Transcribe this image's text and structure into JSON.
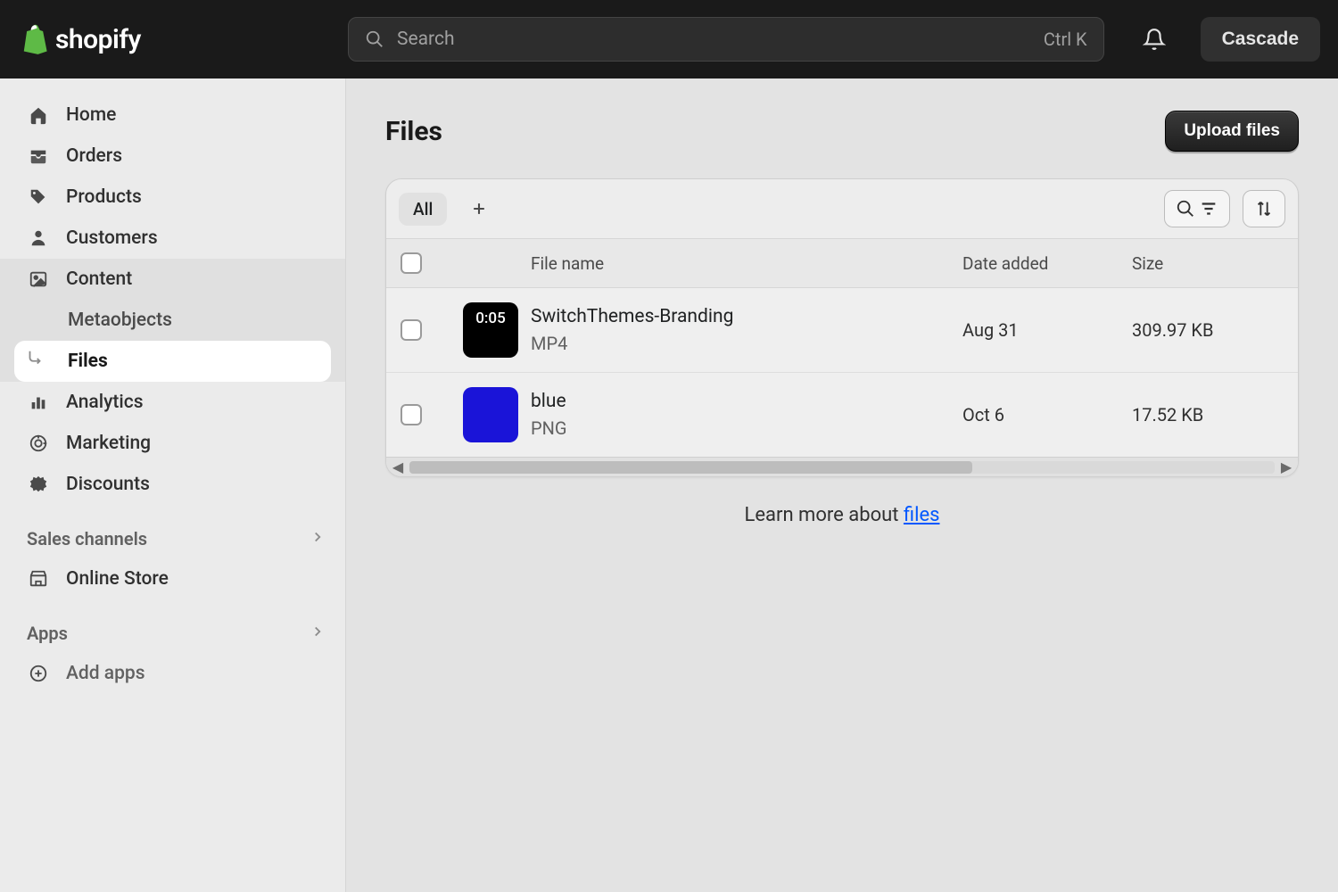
{
  "brand": "shopify",
  "search": {
    "placeholder": "Search",
    "shortcut": "Ctrl K"
  },
  "store_name": "Cascade",
  "sidebar": {
    "items": [
      {
        "label": "Home"
      },
      {
        "label": "Orders"
      },
      {
        "label": "Products"
      },
      {
        "label": "Customers"
      },
      {
        "label": "Content"
      },
      {
        "label": "Analytics"
      },
      {
        "label": "Marketing"
      },
      {
        "label": "Discounts"
      }
    ],
    "content_sub": [
      {
        "label": "Metaobjects"
      },
      {
        "label": "Files"
      }
    ],
    "sales_channels_header": "Sales channels",
    "sales_channels": [
      {
        "label": "Online Store"
      }
    ],
    "apps_header": "Apps",
    "apps": [
      {
        "label": "Add apps"
      }
    ]
  },
  "page": {
    "title": "Files",
    "upload_label": "Upload files",
    "tab_all": "All",
    "columns": {
      "filename": "File name",
      "date": "Date added",
      "size": "Size"
    },
    "rows": [
      {
        "thumb_type": "video",
        "duration": "0:05",
        "name": "SwitchThemes-Branding",
        "type": "MP4",
        "date": "Aug 31",
        "size": "309.97 KB"
      },
      {
        "thumb_type": "blue",
        "name": "blue",
        "type": "PNG",
        "date": "Oct 6",
        "size": "17.52 KB"
      }
    ],
    "learn_prefix": "Learn more about ",
    "learn_link": "files"
  }
}
